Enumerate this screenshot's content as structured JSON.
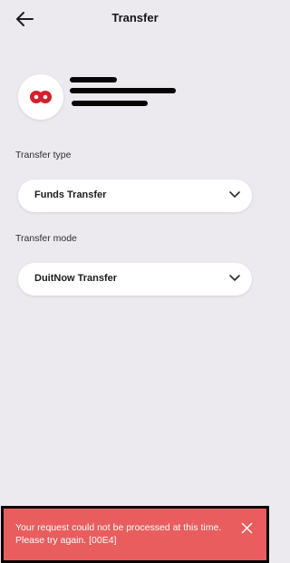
{
  "header": {
    "title": "Transfer",
    "back_icon": "arrow-left-icon"
  },
  "account": {
    "logo_icon": "bank-logo-icon",
    "accent": "#d4202b"
  },
  "transfer_type": {
    "label": "Transfer type",
    "value": "Funds Transfer",
    "icon": "chevron-down-icon"
  },
  "transfer_mode": {
    "label": "Transfer mode",
    "value": "DuitNow Transfer",
    "icon": "chevron-down-icon"
  },
  "toast": {
    "message": "Your request could not be processed at this time. Please try again. [00E4]",
    "close_icon": "close-icon",
    "background": "#e95d5e"
  }
}
